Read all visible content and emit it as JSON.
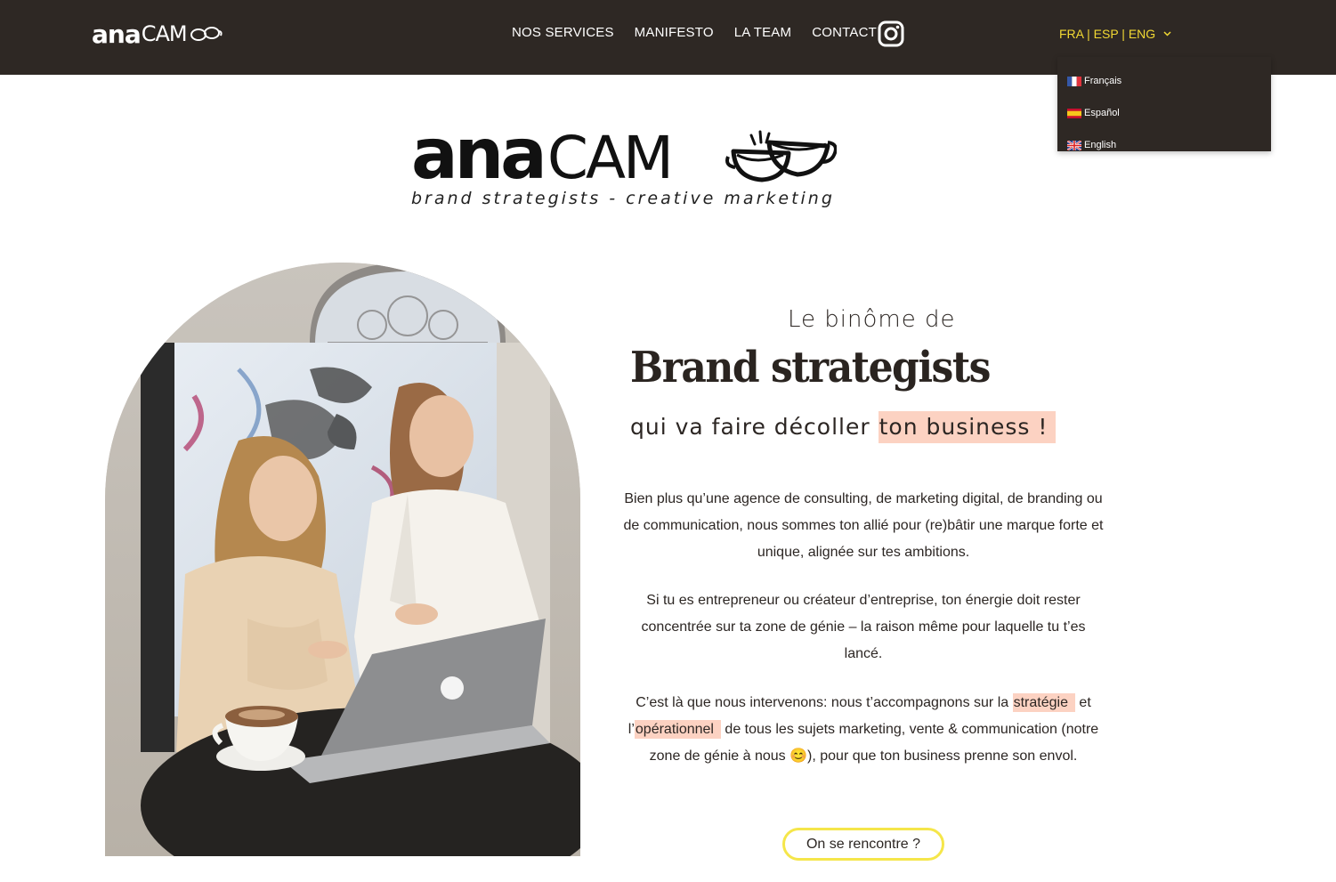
{
  "header": {
    "logo_text_bold": "ana",
    "logo_text_light": "CAM",
    "nav": [
      {
        "label": "NOS SERVICES"
      },
      {
        "label": "MANIFESTO"
      },
      {
        "label": "LA TEAM"
      },
      {
        "label": "CONTACT"
      }
    ],
    "social_icon": "instagram-icon",
    "lang_switch_label": "FRA | ESP | ENG",
    "lang_menu": [
      {
        "label": "Français",
        "flag": "fr-flag-icon"
      },
      {
        "label": "Español",
        "flag": "es-flag-icon"
      },
      {
        "label": "English",
        "flag": "gb-flag-icon"
      }
    ]
  },
  "hero_logo": {
    "bold": "ana",
    "light": "CAM",
    "tagline": "brand strategists - creative marketing"
  },
  "hero": {
    "intro": "Le binôme de",
    "headline": "Brand strategists",
    "sub_prefix": "qui va faire décoller ",
    "sub_highlight": "ton business !",
    "p1": "Bien plus qu’une agence de consulting, de marketing digital, de branding ou de communication, nous sommes ton allié pour (re)bâtir une marque forte et unique, alignée sur tes ambitions.",
    "p2": "Si tu es entrepreneur ou créateur d’entreprise, ton énergie doit rester concentrée sur ta zone de génie – la raison même pour laquelle tu t’es lancé.",
    "p3_a": "C’est là que nous intervenons: nous t’accompagnons sur la ",
    "p3_hl1": "stratégie",
    "p3_b": " et l’",
    "p3_hl2": "opérationnel",
    "p3_c": " de tous les sujets marketing, vente & communication (notre zone de génie à nous ",
    "p3_emoji": "😊",
    "p3_d": "), pour que ton business prenne son envol.",
    "cta": "On se rencontre ?"
  },
  "colors": {
    "header_bg": "#2e2824",
    "accent_yellow": "#f2d933",
    "highlight_peach": "#fcd2c2",
    "text_dark": "#2c2623"
  }
}
